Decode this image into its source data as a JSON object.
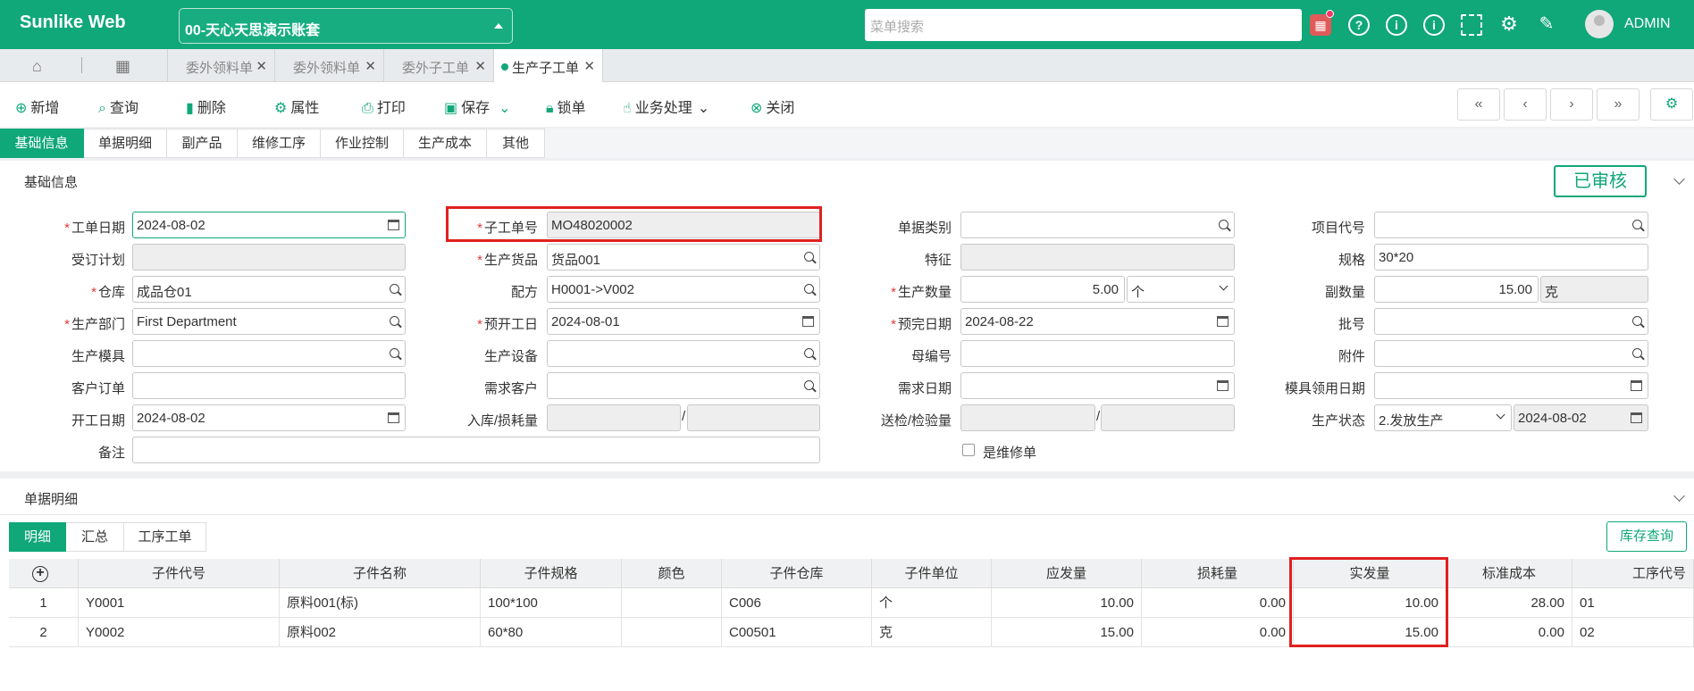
{
  "app": {
    "title": "Sunlike Web",
    "account": "00-天心天思演示账套",
    "search_placeholder": "菜单搜索",
    "user": "ADMIN"
  },
  "tabs": [
    "委外领料单",
    "委外领料单",
    "委外子工单",
    "生产子工单"
  ],
  "toolbar": {
    "add": "新增",
    "query": "查询",
    "delete": "删除",
    "props": "属性",
    "print": "打印",
    "save": "保存",
    "lock": "锁单",
    "business": "业务处理",
    "close": "关闭"
  },
  "subtabs": [
    "基础信息",
    "单据明细",
    "副产品",
    "维修工序",
    "作业控制",
    "生产成本",
    "其他"
  ],
  "basic": {
    "title": "基础信息",
    "status": "已审核",
    "labels": {
      "order_date": "工单日期",
      "sub_no": "子工单号",
      "doc_type": "单据类别",
      "project": "项目代号",
      "plan": "受订计划",
      "goods": "生产货品",
      "feature": "特征",
      "spec": "规格",
      "warehouse": "仓库",
      "formula": "配方",
      "qty": "生产数量",
      "sub_qty": "副数量",
      "dept": "生产部门",
      "pre_start": "预开工日",
      "pre_end": "预完日期",
      "batch": "批号",
      "mold": "生产模具",
      "equip": "生产设备",
      "parent": "母编号",
      "attach": "附件",
      "cust_order": "客户订单",
      "demand_cust": "需求客户",
      "demand_date": "需求日期",
      "mold_date": "模具领用日期",
      "start_date": "开工日期",
      "in_loss": "入库/损耗量",
      "inspect": "送检/检验量",
      "prod_status": "生产状态",
      "remark": "备注",
      "repair": "是维修单"
    },
    "values": {
      "order_date": "2024-08-02",
      "sub_no": "MO48020002",
      "goods": "货品001",
      "spec": "30*20",
      "warehouse": "成品仓01",
      "formula": "H0001->V002",
      "qty": "5.00",
      "qty_unit": "个",
      "sub_qty": "15.00",
      "sub_unit": "克",
      "dept": "First Department",
      "pre_start": "2024-08-01",
      "pre_end": "2024-08-22",
      "start_date": "2024-08-02",
      "prod_status": "2.发放生产",
      "status_date": "2024-08-02"
    }
  },
  "detail": {
    "title": "单据明细",
    "tabs": [
      "明细",
      "汇总",
      "工序工单"
    ],
    "stock_btn": "库存查询",
    "headers": [
      "子件代号",
      "子件名称",
      "子件规格",
      "颜色",
      "子件仓库",
      "子件单位",
      "应发量",
      "损耗量",
      "实发量",
      "标准成本",
      "工序代号"
    ],
    "rows": [
      {
        "no": "1",
        "code": "Y0001",
        "name": "原料001(标)",
        "spec": "100*100",
        "color": "",
        "wh": "C006",
        "unit": "个",
        "need": "10.00",
        "loss": "0.00",
        "actual": "10.00",
        "cost": "28.00",
        "proc": "01"
      },
      {
        "no": "2",
        "code": "Y0002",
        "name": "原料002",
        "spec": "60*80",
        "color": "",
        "wh": "C00501",
        "unit": "克",
        "need": "15.00",
        "loss": "0.00",
        "actual": "15.00",
        "cost": "0.00",
        "proc": "02"
      }
    ]
  },
  "colors": {
    "primary": "#10a779",
    "highlight": "#e02020"
  }
}
